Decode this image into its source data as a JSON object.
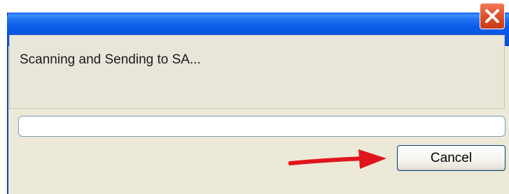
{
  "dialog": {
    "status_text": "Scanning and Sending to SA...",
    "progress_fraction": 0.0,
    "cancel_label": "Cancel"
  },
  "icons": {
    "close": "close-icon",
    "annotation": "red-arrow-icon"
  },
  "colors": {
    "titlebar": "#0b5ce8",
    "close_button": "#e2532e",
    "dialog_background": "#ece9d8",
    "annotation_arrow": "#e0141c"
  }
}
